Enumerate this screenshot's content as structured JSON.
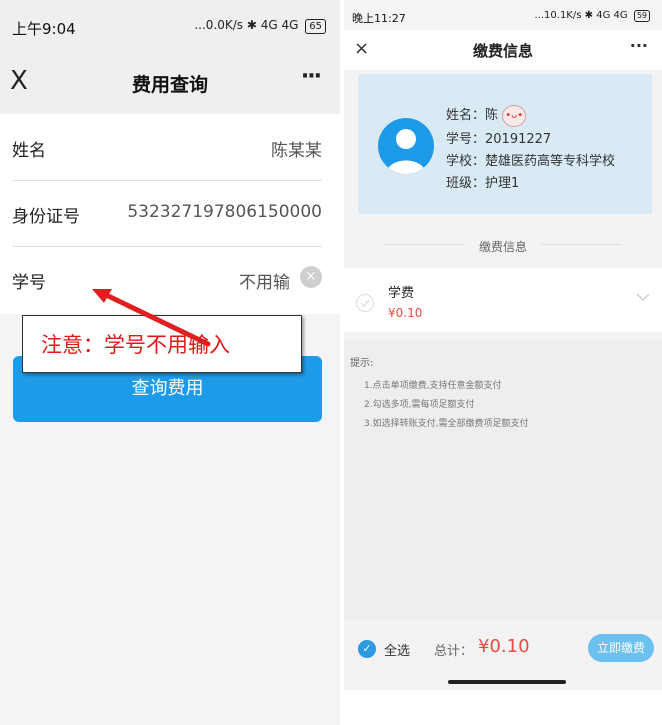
{
  "left": {
    "statusbar": {
      "time": "上午9:04",
      "network": "...0.0K/s",
      "signal": "4G 4G",
      "battery": "65"
    },
    "navbar": {
      "close": "X",
      "title": "费用查询",
      "more": "···"
    },
    "form": {
      "rows": [
        {
          "label": "姓名",
          "value": "陈某某"
        },
        {
          "label": "身份证号",
          "value": "532327197806150000"
        },
        {
          "label": "学号",
          "value": "不用输"
        }
      ],
      "clear": "×"
    },
    "query_button": "查询费用",
    "annotation": "注意：学号不用输入",
    "colors": {
      "button": "#1e9be8",
      "annotation_text": "#e01818",
      "arrow": "#e02020"
    }
  },
  "right": {
    "statusbar": {
      "time": "晚上11:27",
      "network": "...10.1K/s",
      "signal": "4G 4G",
      "battery": "59"
    },
    "navbar": {
      "close": "×",
      "title": "缴费信息",
      "more": "···"
    },
    "student": {
      "name": "姓名：陈",
      "id": "学号：20191227",
      "school": "学校：楚雄医药高等专科学校",
      "class": "班级：护理1"
    },
    "section_title": "缴费信息",
    "fee": {
      "name": "学费",
      "amount": "¥0.10"
    },
    "tips": {
      "head": "提示:",
      "items": [
        "1.点击单项缴费,支持任意金额支付",
        "2.勾选多项,需每项足额支付",
        "3.如选择转账支付,需全部缴费项足额支付"
      ]
    },
    "bottom": {
      "select_all": "全选",
      "total_label": "总计：",
      "total_value": "¥0.10",
      "pay_button": "立即缴费"
    },
    "colors": {
      "card": "#d9eaf4",
      "accent": "#1e9be8",
      "price": "#e54d42"
    }
  }
}
